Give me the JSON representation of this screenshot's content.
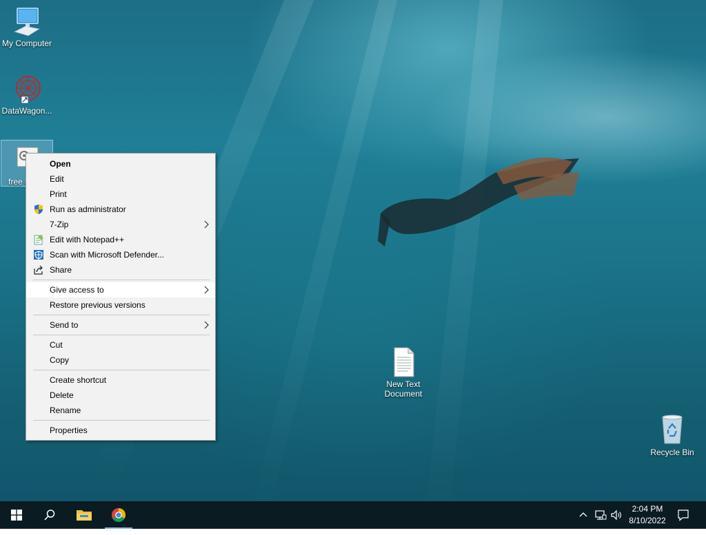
{
  "desktop": {
    "icons": {
      "my_computer": "My Computer",
      "datawagon": "DataWagon...",
      "selected_file": "free u",
      "new_text_document": "New Text Document",
      "recycle_bin": "Recycle Bin"
    }
  },
  "context_menu": {
    "items": {
      "open": "Open",
      "edit": "Edit",
      "print": "Print",
      "run_as_admin": "Run as administrator",
      "seven_zip": "7-Zip",
      "edit_notepadpp": "Edit with Notepad++",
      "scan_defender": "Scan with Microsoft Defender...",
      "share": "Share",
      "give_access": "Give access to",
      "restore_versions": "Restore previous versions",
      "send_to": "Send to",
      "cut": "Cut",
      "copy": "Copy",
      "create_shortcut": "Create shortcut",
      "delete": "Delete",
      "rename": "Rename",
      "properties": "Properties"
    },
    "submenu_arrow": ">",
    "highlighted_item": "Give access to"
  },
  "taskbar": {
    "time": "2:04 PM",
    "date": "8/10/2022"
  },
  "icons": {
    "start": "windows-logo-icon",
    "search": "search-icon",
    "explorer": "folder-icon",
    "chrome": "chrome-icon",
    "tray_chevron": "chevron-up-icon",
    "network": "network-icon",
    "volume": "speaker-icon",
    "notifications": "notification-icon"
  },
  "colors": {
    "taskbar": "#0b1b22",
    "menu_bg": "#f2f2f2",
    "desktop_water": "#1d6e86",
    "active_indicator": "#7fb5e0"
  }
}
